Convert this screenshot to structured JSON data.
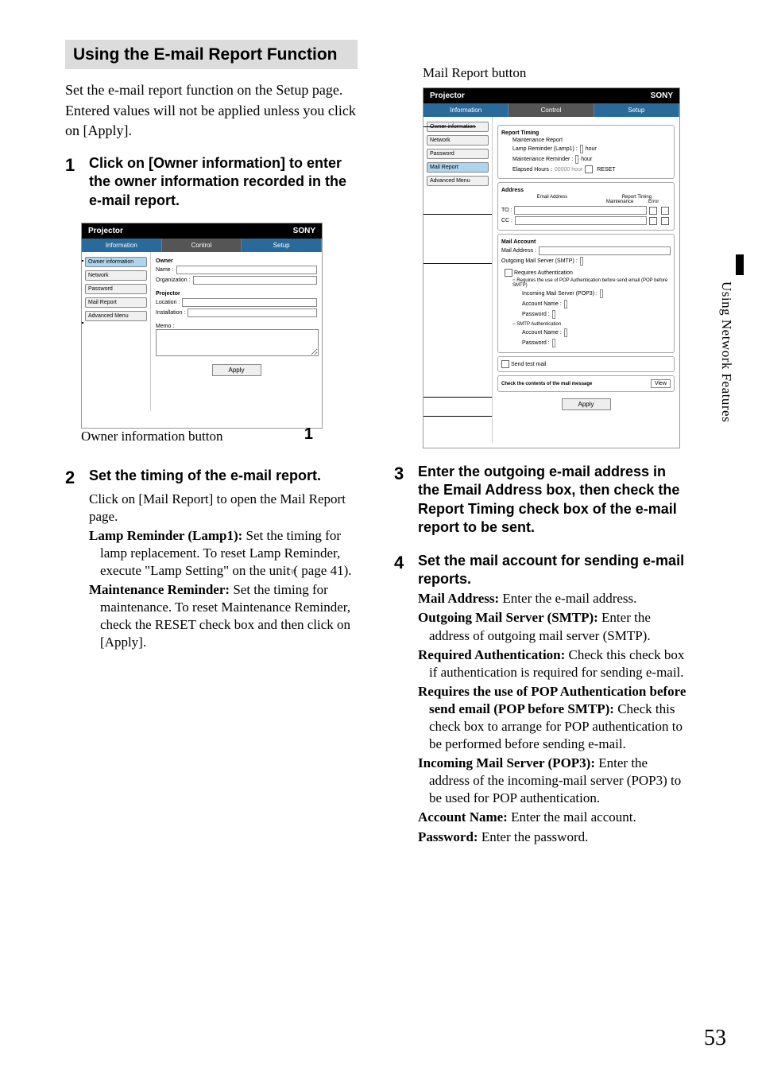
{
  "section_title": "Using the E-mail Report Function",
  "intro1": "Set the e-mail report function on the Setup page.",
  "intro2": "Entered values will not be applied unless you click on [Apply].",
  "side_tab": "Using Network Features",
  "page_number": "53",
  "mini_common": {
    "brand_left": "Projector",
    "brand_right": "SONY",
    "tab_info": "Information",
    "tab_control": "Control",
    "tab_setup": "Setup",
    "side_owner": "Owner information",
    "side_network": "Network",
    "side_password": "Password",
    "side_mail": "Mail Report",
    "side_adv": "Advanced Menu",
    "apply": "Apply"
  },
  "mini1": {
    "grp_owner": "Owner",
    "name_lbl": "Name :",
    "org_lbl": "Organization :",
    "grp_proj": "Projector",
    "loc_lbl": "Location :",
    "inst_lbl": "Installation :",
    "memo_lbl": "Memo :",
    "caption": "Owner information button",
    "ref": "1"
  },
  "mini2": {
    "caption": "Mail Report button",
    "sec_rt": "Report Timing",
    "mr": "Maintenance Report",
    "lamp_lbl": "Lamp Reminder (Lamp1) :",
    "maint_lbl": "Maintenance Reminder :",
    "hour": "hour",
    "elapsed": "Elapsed Hours :",
    "reset": "RESET",
    "sec_addr": "Address",
    "email_addr": "Email Address",
    "rt": "Report Timing",
    "mt": "Maintenance",
    "err": "Error",
    "to": "TO :",
    "cc": "CC :",
    "sec_acct": "Mail Account",
    "mail_addr": "Mail Address :",
    "smtp": "Outgoing Mail Server (SMTP) :",
    "req_auth": "Requires Authentication",
    "pop_before": "Requires the use of POP Authentication before send email (POP before SMTP)",
    "pop3": "Incoming Mail Server (POP3) :",
    "acct": "Account Name :",
    "pwd": "Password :",
    "smtp_auth": "SMTP Authentication",
    "send_test": "Send test mail",
    "check_msg": "Check the contents of the mail message",
    "view": "View"
  },
  "steps": {
    "s1_title": "Click on [Owner information] to enter the owner information recorded in the e-mail report.",
    "s2_title": "Set the timing of the e-mail report.",
    "s2_a": "Click on [Mail Report] to open the Mail Report page.",
    "s2_b_head": "Lamp Reminder (Lamp1):",
    "s2_b_body": " Set the timing for lamp replacement. To reset Lamp Reminder, execute \"Lamp Setting\" on the unit (",
    "s2_b_ref": " page 41).",
    "s2_c_head": "Maintenance Reminder:",
    "s2_c_body": " Set the timing for maintenance. To reset Maintenance Reminder, check the RESET check box and then click on [Apply].",
    "s3_title": "Enter the outgoing e-mail address in the Email Address box, then check the Report Timing check box of the e-mail report to be sent.",
    "s4_title": "Set the mail account for sending e-mail reports.",
    "s4_a_head": "Mail Address:",
    "s4_a_body": " Enter the e-mail address.",
    "s4_b_head": "Outgoing Mail Server (SMTP):",
    "s4_b_body": " Enter the address of outgoing mail server (SMTP).",
    "s4_c_head": "Required Authentication:",
    "s4_c_body": " Check this check box if authentication is required for sending e-mail.",
    "s4_d_head": "Requires the use of POP Authentication before send email (POP before SMTP):",
    "s4_d_body": " Check this check box to arrange for POP authentication to be performed before sending e-mail.",
    "s4_e_head": "Incoming Mail Server (POP3):",
    "s4_e_body": " Enter the address of the incoming-mail server (POP3) to be used for POP authentication.",
    "s4_f_head": "Account Name:",
    "s4_f_body": " Enter the mail account.",
    "s4_g_head": "Password:",
    "s4_g_body": " Enter the password."
  }
}
